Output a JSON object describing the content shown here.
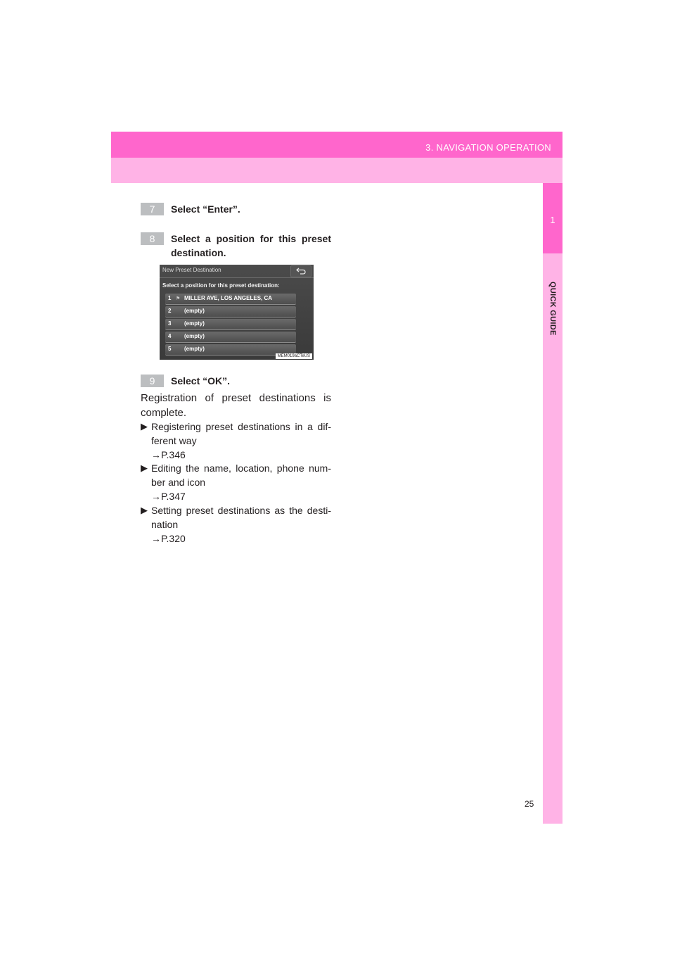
{
  "header": {
    "section_title": "3. NAVIGATION OPERATION"
  },
  "side_tab": {
    "chapter_number": "1",
    "chapter_label": "QUICK GUIDE"
  },
  "steps": [
    {
      "number": "7",
      "text": "Select “Enter”."
    },
    {
      "number": "8",
      "text": "Select a position for this preset destination."
    },
    {
      "number": "9",
      "text": "Select “OK”."
    }
  ],
  "screen": {
    "title": "New Preset Destination",
    "prompt": "Select a position for this preset destination:",
    "slots": [
      {
        "number": "1",
        "label": "MILLER AVE, LOS ANGELES, CA"
      },
      {
        "number": "2",
        "label": "(empty)"
      },
      {
        "number": "3",
        "label": "(empty)"
      },
      {
        "number": "4",
        "label": "(empty)"
      },
      {
        "number": "5",
        "label": "(empty)"
      }
    ],
    "code": "MEM019aCTeUS"
  },
  "body": {
    "completion": "Registration of preset destinations is complete."
  },
  "bullets": [
    {
      "text": "Registering preset destinations in a dif-ferent way",
      "ref": "→P.346"
    },
    {
      "text": "Editing the name, location, phone num-ber and icon",
      "ref": "→P.347"
    },
    {
      "text": "Setting preset destinations as the desti-nation",
      "ref": "→P.320"
    }
  ],
  "footer": {
    "page_number": "25"
  }
}
